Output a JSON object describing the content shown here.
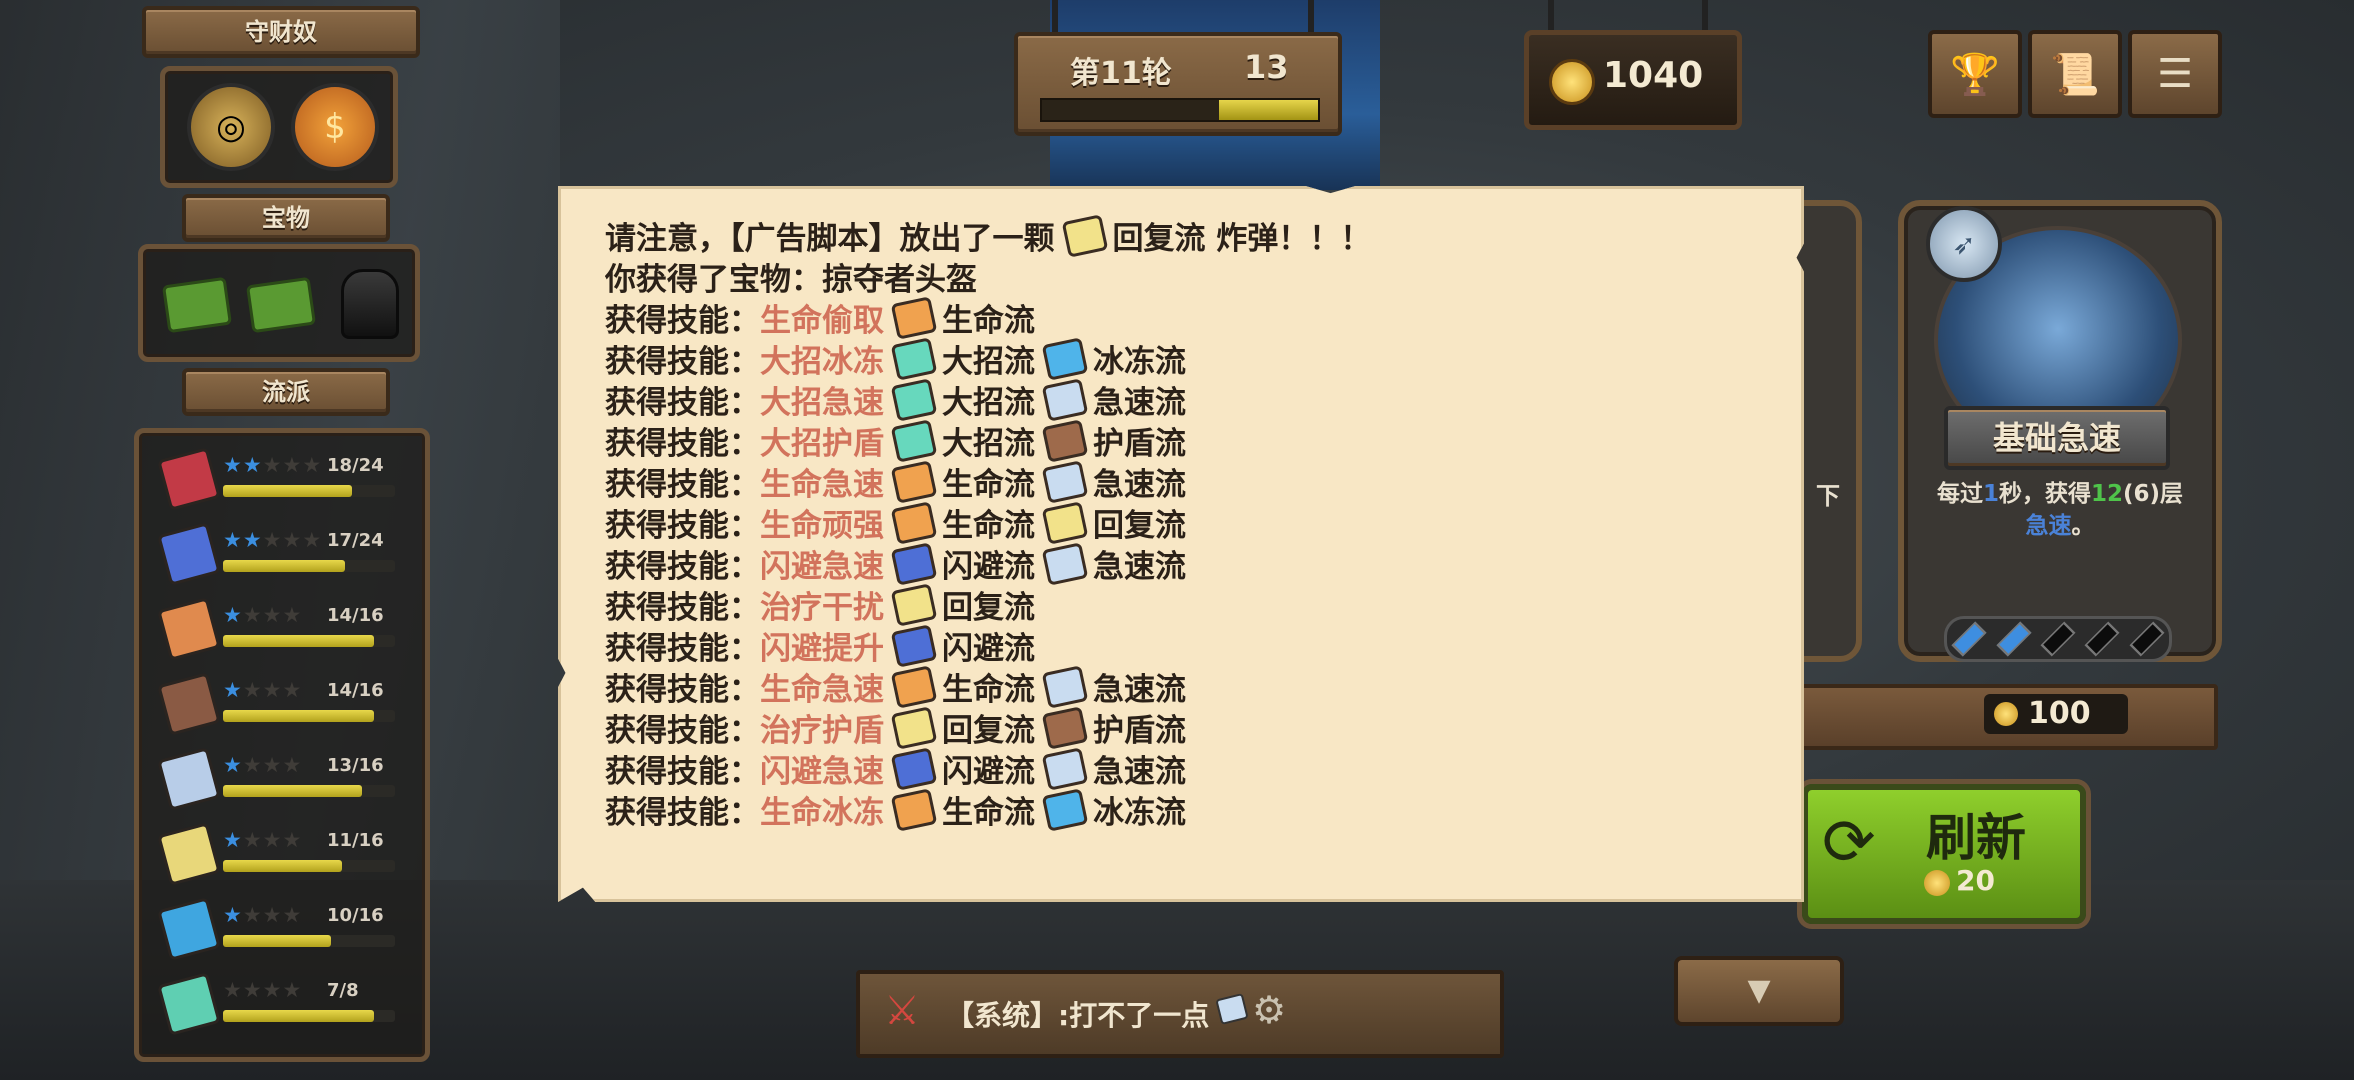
{
  "left_panel": {
    "guardian_title": "守财奴",
    "treasure_title": "宝物",
    "schools_title": "流派",
    "schools": [
      {
        "stars_on": 2,
        "stars_total": 5,
        "count": "18/24",
        "progress": 0.75,
        "color": "#c23a46"
      },
      {
        "stars_on": 2,
        "stars_total": 5,
        "count": "17/24",
        "progress": 0.71,
        "color": "#4f6fd6"
      },
      {
        "stars_on": 1,
        "stars_total": 4,
        "count": "14/16",
        "progress": 0.875,
        "color": "#e08a4e"
      },
      {
        "stars_on": 1,
        "stars_total": 4,
        "count": "14/16",
        "progress": 0.875,
        "color": "#8a5a44"
      },
      {
        "stars_on": 1,
        "stars_total": 4,
        "count": "13/16",
        "progress": 0.81,
        "color": "#b8cde8"
      },
      {
        "stars_on": 1,
        "stars_total": 4,
        "count": "11/16",
        "progress": 0.69,
        "color": "#e8d77a"
      },
      {
        "stars_on": 1,
        "stars_total": 4,
        "count": "10/16",
        "progress": 0.625,
        "color": "#3fa6e0"
      },
      {
        "stars_on": 0,
        "stars_total": 4,
        "count": "7/8",
        "progress": 0.875,
        "color": "#5fcfb2"
      }
    ]
  },
  "top": {
    "round_label": "第11轮",
    "timer": "13",
    "round_progress": 0.36,
    "gold": "1040"
  },
  "notification": {
    "line1_pre": "请注意，【广告脚本】放出了一颗",
    "line1_post": "回复流 炸弹！！！",
    "line2": "你获得了宝物：掠夺者头盔",
    "skill_prefix": "获得技能：",
    "skills": [
      {
        "name": "生命偷取",
        "tags": [
          {
            "cls": "life",
            "label": "生命流"
          }
        ]
      },
      {
        "name": "大招冰冻",
        "tags": [
          {
            "cls": "ult",
            "label": "大招流"
          },
          {
            "cls": "ice",
            "label": "冰冻流"
          }
        ]
      },
      {
        "name": "大招急速",
        "tags": [
          {
            "cls": "ult",
            "label": "大招流"
          },
          {
            "cls": "speed",
            "label": "急速流"
          }
        ]
      },
      {
        "name": "大招护盾",
        "tags": [
          {
            "cls": "ult",
            "label": "大招流"
          },
          {
            "cls": "shield",
            "label": "护盾流"
          }
        ]
      },
      {
        "name": "生命急速",
        "tags": [
          {
            "cls": "life",
            "label": "生命流"
          },
          {
            "cls": "speed",
            "label": "急速流"
          }
        ]
      },
      {
        "name": "生命顽强",
        "tags": [
          {
            "cls": "life",
            "label": "生命流"
          },
          {
            "cls": "heal",
            "label": "回复流"
          }
        ]
      },
      {
        "name": "闪避急速",
        "tags": [
          {
            "cls": "dodge",
            "label": "闪避流"
          },
          {
            "cls": "speed",
            "label": "急速流"
          }
        ]
      },
      {
        "name": "治疗干扰",
        "tags": [
          {
            "cls": "heal",
            "label": "回复流"
          }
        ]
      },
      {
        "name": "闪避提升",
        "tags": [
          {
            "cls": "dodge",
            "label": "闪避流"
          }
        ]
      },
      {
        "name": "生命急速",
        "tags": [
          {
            "cls": "life",
            "label": "生命流"
          },
          {
            "cls": "speed",
            "label": "急速流"
          }
        ]
      },
      {
        "name": "治疗护盾",
        "tags": [
          {
            "cls": "heal",
            "label": "回复流"
          },
          {
            "cls": "shield",
            "label": "护盾流"
          }
        ]
      },
      {
        "name": "闪避急速",
        "tags": [
          {
            "cls": "dodge",
            "label": "闪避流"
          },
          {
            "cls": "speed",
            "label": "急速流"
          }
        ]
      },
      {
        "name": "生命冰冻",
        "tags": [
          {
            "cls": "life",
            "label": "生命流"
          },
          {
            "cls": "ice",
            "label": "冰冻流"
          }
        ]
      }
    ]
  },
  "card": {
    "title": "基础急速",
    "desc_pre": "每过",
    "desc_num1": "1",
    "desc_mid": "秒，获得",
    "desc_num2": "12",
    "desc_paren": "(6)",
    "desc_post": "层",
    "desc_line2": "急速",
    "desc_end": "。",
    "partial_text": "下",
    "price": "100",
    "gems_filled": 2,
    "gems_total": 5
  },
  "refresh": {
    "label": "刷新",
    "cost": "20"
  },
  "chat": {
    "text": "【系统】:打不了一点"
  },
  "colors": {
    "accent_green": "#7fb81e",
    "skill_name": "#d2735c",
    "star_blue": "#3b8fe0",
    "bar_yellow": "#d8c832"
  }
}
